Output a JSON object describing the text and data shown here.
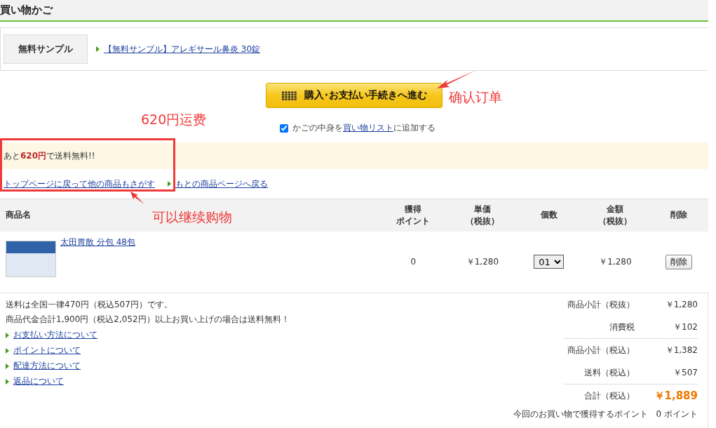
{
  "page_title": "買い物かご",
  "free_sample": {
    "label": "無料サンプル",
    "link": "【無料サンプル】アレギサール鼻炎 30錠"
  },
  "checkout_button": "購入･お支払い手続きへ進む",
  "add_to_list": {
    "checked": true,
    "before": "かごの中身を",
    "link": "買い物リスト",
    "after": "に追加する"
  },
  "notice": "あと**620円**で送料無料!!",
  "nav_links": [
    {
      "text": "トップページに戻って他の商品もさがす",
      "arrow": false
    },
    {
      "text": "もとの商品ページへ戻る",
      "arrow": true
    }
  ],
  "table": {
    "columns": [
      [
        "商品名"
      ],
      [
        "獲得",
        "ポイント"
      ],
      [
        "単価",
        "（税抜）"
      ],
      [
        "個数"
      ],
      [
        "金額",
        "（税抜）"
      ],
      [
        "削除"
      ]
    ],
    "rows": [
      {
        "name": "太田胃散 分包 48包",
        "points": "0",
        "price": "￥1,280",
        "quantity": "01",
        "amount": "￥1,280",
        "delete": "削除"
      }
    ]
  },
  "shipping_notes": [
    "送料は全国一律470円（税込507円）です。",
    "商品代金合計1,900円（税込2,052円）以上お買い上げの場合は送料無料！"
  ],
  "info_links": [
    "お支払い方法について",
    "ポイントについて",
    "配達方法について",
    "返品について"
  ],
  "summary": [
    {
      "rows": [
        {
          "label": "商品小計（税抜）",
          "value": "￥1,280",
          "kind": "normal"
        },
        {
          "label": "消費税",
          "value": "￥102",
          "kind": "normal"
        }
      ]
    },
    {
      "rows": [
        {
          "label": "商品小計（税込）",
          "value": "￥1,382",
          "kind": "normal"
        },
        {
          "label": "送料（税込）",
          "value": "￥507",
          "kind": "normal"
        }
      ]
    },
    {
      "rows": [
        {
          "label": "合計（税込）",
          "value": "￥1,889",
          "kind": "total"
        }
      ]
    }
  ],
  "points_earned": {
    "label": "今回のお買い物で獲得するポイント",
    "value": "0 ポイント"
  },
  "annotations": [
    "620円运费",
    "确认订单",
    "可以继续购物"
  ]
}
